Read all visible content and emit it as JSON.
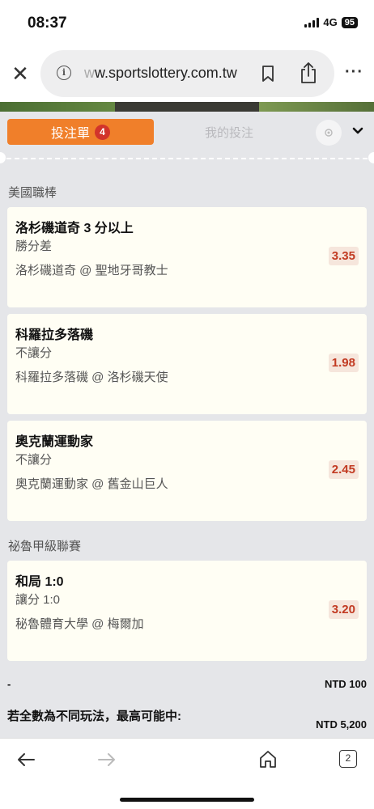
{
  "status_bar": {
    "time": "08:37",
    "network": "4G",
    "battery": "95"
  },
  "browser": {
    "url_faded": "w",
    "url": "w.sportslottery.com.tw",
    "open_tabs": "2"
  },
  "slip": {
    "tab_active_label": "投注單",
    "tab_active_count": "4",
    "tab_inactive_label": "我的投注",
    "leagues": [
      {
        "name": "美國職棒",
        "bets": [
          {
            "selection": "洛杉磯道奇 3 分以上",
            "market": "勝分差",
            "match": "洛杉磯道奇 @ 聖地牙哥教士",
            "odds": "3.35"
          },
          {
            "selection": "科羅拉多落磯",
            "market": "不讓分",
            "match": "科羅拉多落磯 @ 洛杉磯天使",
            "odds": "1.98"
          },
          {
            "selection": "奧克蘭運動家",
            "market": "不讓分",
            "match": "奧克蘭運動家 @ 舊金山巨人",
            "odds": "2.45"
          }
        ]
      },
      {
        "name": "祕魯甲級聯賽",
        "bets": [
          {
            "selection": "和局 1:0",
            "market": "讓分 1:0",
            "match": "秘魯體育大學 @ 梅爾加",
            "odds": "3.20"
          }
        ]
      }
    ],
    "summary": {
      "row1_label": "-",
      "row1_amount": "NTD 100",
      "row2_label": "若全數為不同玩法，最高可能中:",
      "row2_amount": "NTD 5,200"
    }
  },
  "colors": {
    "accent_orange": "#f07f2a",
    "badge_red": "#d2342b",
    "odds_red": "#c23b22",
    "panel_bg": "#e5e6e9",
    "card_bg": "#fffef4"
  }
}
